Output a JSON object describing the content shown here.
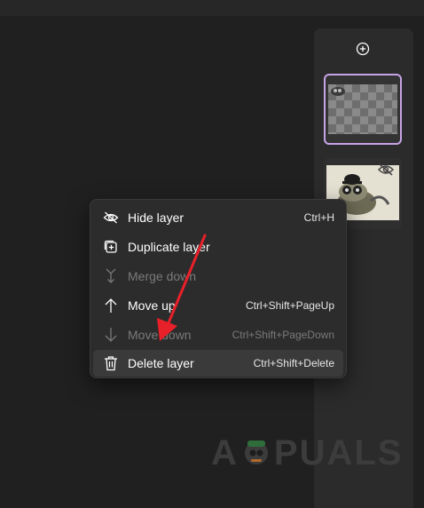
{
  "panel": {
    "add_icon": "plus-circle-icon",
    "layers": [
      {
        "selected": true,
        "hidden": false
      },
      {
        "selected": false,
        "hidden": true,
        "status_icon": "eye-off-icon"
      }
    ]
  },
  "menu": {
    "items": [
      {
        "label": "Hide layer",
        "shortcut": "Ctrl+H",
        "icon": "eye-off-icon",
        "enabled": true
      },
      {
        "label": "Duplicate layer",
        "shortcut": "",
        "icon": "duplicate-icon",
        "enabled": true
      },
      {
        "label": "Merge down",
        "shortcut": "",
        "icon": "merge-down-icon",
        "enabled": false
      },
      {
        "label": "Move up",
        "shortcut": "Ctrl+Shift+PageUp",
        "icon": "arrow-up-icon",
        "enabled": true
      },
      {
        "label": "Move down",
        "shortcut": "Ctrl+Shift+PageDown",
        "icon": "arrow-down-icon",
        "enabled": false
      },
      {
        "label": "Delete layer",
        "shortcut": "Ctrl+Shift+Delete",
        "icon": "trash-icon",
        "enabled": true,
        "highlighted": true
      }
    ]
  },
  "annotation": {
    "color": "#e8202a"
  },
  "watermark": {
    "left": "A",
    "right": "PUALS"
  },
  "colors": {
    "selection": "#c7a4e6",
    "background": "#202020",
    "menu": "#2c2c2c"
  }
}
